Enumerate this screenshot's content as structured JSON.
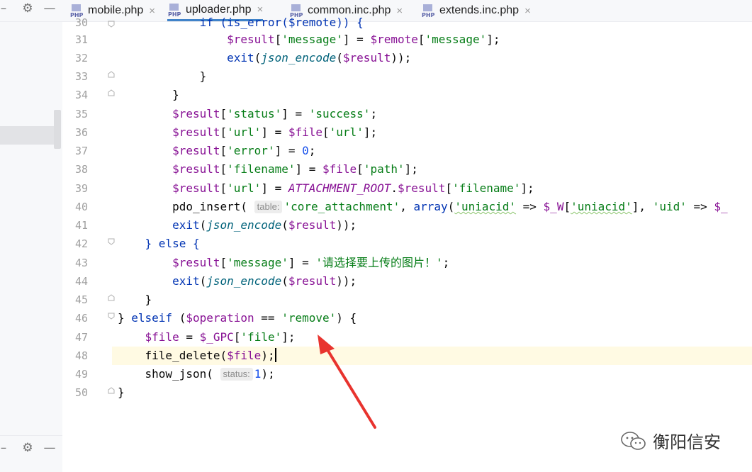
{
  "tabs": [
    {
      "label": "mobile.php",
      "icon": "php-file-icon",
      "active": false
    },
    {
      "label": "uploader.php",
      "icon": "php-file-icon",
      "active": true
    },
    {
      "label": "common.inc.php",
      "icon": "php-file-icon",
      "active": false
    },
    {
      "label": "extends.inc.php",
      "icon": "php-file-icon",
      "active": false
    }
  ],
  "file_icon_text": "PHP",
  "tab_close_glyph": "×",
  "left_panel": {
    "gear_icon": "gear-icon",
    "minimize_icon": "minimize-icon"
  },
  "line_numbers": [
    "30",
    "31",
    "32",
    "33",
    "34",
    "35",
    "36",
    "37",
    "38",
    "39",
    "40",
    "41",
    "42",
    "43",
    "44",
    "45",
    "46",
    "47",
    "48",
    "49",
    "50"
  ],
  "code": {
    "l30": "if (is_error($remote)) {",
    "l31_var": "$result",
    "l31_str": "'message'",
    "l31_eq": "] = ",
    "l31_var2": "$remote",
    "l31_str2": "'message'",
    "l32_kw": "exit",
    "l32_fn": "json_encode",
    "l32_var": "$result",
    "l35_str": "'status'",
    "l35_val": "'success'",
    "l36_str": "'url'",
    "l36_var2": "$file",
    "l36_str2": "'url'",
    "l37_str": "'error'",
    "l37_num": "0",
    "l38_str": "'filename'",
    "l38_str2": "'path'",
    "l39_str": "'url'",
    "l39_const": "ATTACHMENT_ROOT",
    "l39_str2": "'filename'",
    "l40_fn": "pdo_insert",
    "l40_hint": "table:",
    "l40_str": "'core_attachment'",
    "l40_kw": "array",
    "l40_str2": "'uniacid'",
    "l40_var": "$_W",
    "l40_str3": "'uniacid'",
    "l40_str4": "'uid'",
    "l40_var2": "$_",
    "l42_kw": "} else {",
    "l43_str": "'message'",
    "l43_val": "'请选择要上传的图片！'",
    "l46_kw": "elseif",
    "l46_var": "$operation",
    "l46_str": "'remove'",
    "l47_var": "$file",
    "l47_var2": "$_GPC",
    "l47_str": "'file'",
    "l48_fn": "file_delete",
    "l48_var": "$file",
    "l49_fn": "show_json",
    "l49_hint": "status:",
    "l49_num": "1"
  },
  "watermark": {
    "text": "衡阳信安",
    "icon": "wechat-icon"
  },
  "colors": {
    "arrow": "#e8332e",
    "accent": "#4083c9"
  }
}
